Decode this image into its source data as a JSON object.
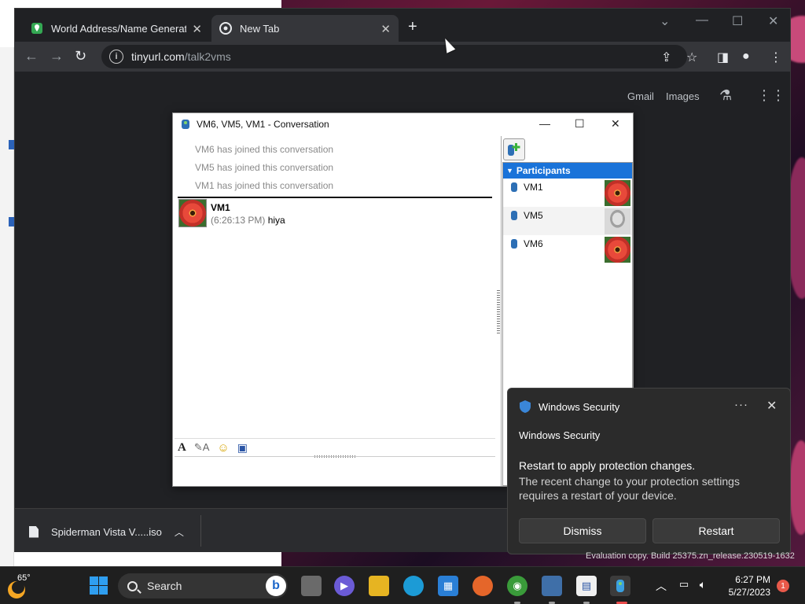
{
  "browser": {
    "tabs": [
      {
        "label": "World Address/Name Generator"
      },
      {
        "label": "New Tab"
      }
    ],
    "url_host": "tinyurl.com",
    "url_path": "/talk2vms",
    "links": {
      "gmail": "Gmail",
      "images": "Images"
    }
  },
  "download": {
    "filename": "Spiderman Vista V.....iso"
  },
  "conversation": {
    "title": "VM6, VM5, VM1 - Conversation",
    "system_messages": [
      "VM6 has joined this conversation",
      "VM5 has joined this conversation",
      "VM1 has joined this conversation"
    ],
    "message": {
      "sender": "VM1",
      "time": "(6:26:13 PM)",
      "text": "hiya"
    },
    "participants_header": "Participants",
    "participants": [
      {
        "name": "VM1",
        "avatar": "flower"
      },
      {
        "name": "VM5",
        "avatar": "alien"
      },
      {
        "name": "VM6",
        "avatar": "flower"
      }
    ]
  },
  "toast": {
    "header": "Windows Security",
    "app": "Windows Security",
    "title": "Restart to apply protection changes.",
    "body": "The recent change to your protection settings requires a restart of your device.",
    "dismiss": "Dismiss",
    "restart": "Restart"
  },
  "watermark": "Evaluation copy. Build 25375.zn_release.230519-1632",
  "taskbar": {
    "temperature": "65°",
    "search_placeholder": "Search",
    "time": "6:27 PM",
    "date": "5/27/2023",
    "notifications": "1"
  },
  "colors": {
    "accent": "#1a73d9",
    "toast_bg": "#2b2b2b",
    "chrome_bg": "#202124"
  }
}
